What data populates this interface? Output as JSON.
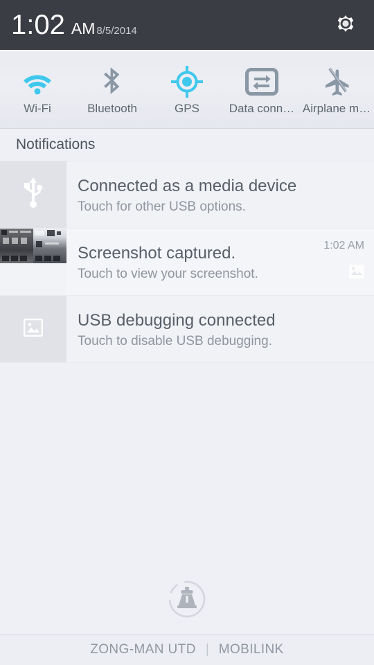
{
  "status_bar": {
    "time": "1:02",
    "ampm": "AM",
    "date": "8/5/2014",
    "settings_icon": "gear-icon",
    "background_color": "#3b3d44"
  },
  "quick_toggles": {
    "accent_on_color": "#3fc8ec",
    "off_color": "#8a97a5",
    "items": [
      {
        "label": "Wi-Fi",
        "icon": "wifi-icon",
        "state": "on"
      },
      {
        "label": "Bluetooth",
        "icon": "bluetooth-icon",
        "state": "off"
      },
      {
        "label": "GPS",
        "icon": "gps-icon",
        "state": "on"
      },
      {
        "label": "Data conn…",
        "icon": "data-connection-icon",
        "state": "off"
      },
      {
        "label": "Airplane m…",
        "icon": "airplane-mode-icon",
        "state": "off"
      }
    ]
  },
  "notifications": {
    "section_title": "Notifications",
    "items": [
      {
        "title": "Connected as a media device",
        "subtitle": "Touch for other USB options.",
        "icon": "usb-icon",
        "time": ""
      },
      {
        "title": "Screenshot captured.",
        "subtitle": "Touch to view your screenshot.",
        "icon": "screenshot-thumbnail",
        "time": "1:02 AM",
        "meta_icon": "image-icon"
      },
      {
        "title": "USB debugging connected",
        "subtitle": "Touch to disable USB debugging.",
        "icon": "image-placeholder-icon",
        "time": ""
      }
    ]
  },
  "panel_handle": {
    "icon": "notification-handle-icon"
  },
  "carrier_bar": {
    "sim1": "ZONG-MAN UTD",
    "separator": "|",
    "sim2": "MOBILINK"
  }
}
